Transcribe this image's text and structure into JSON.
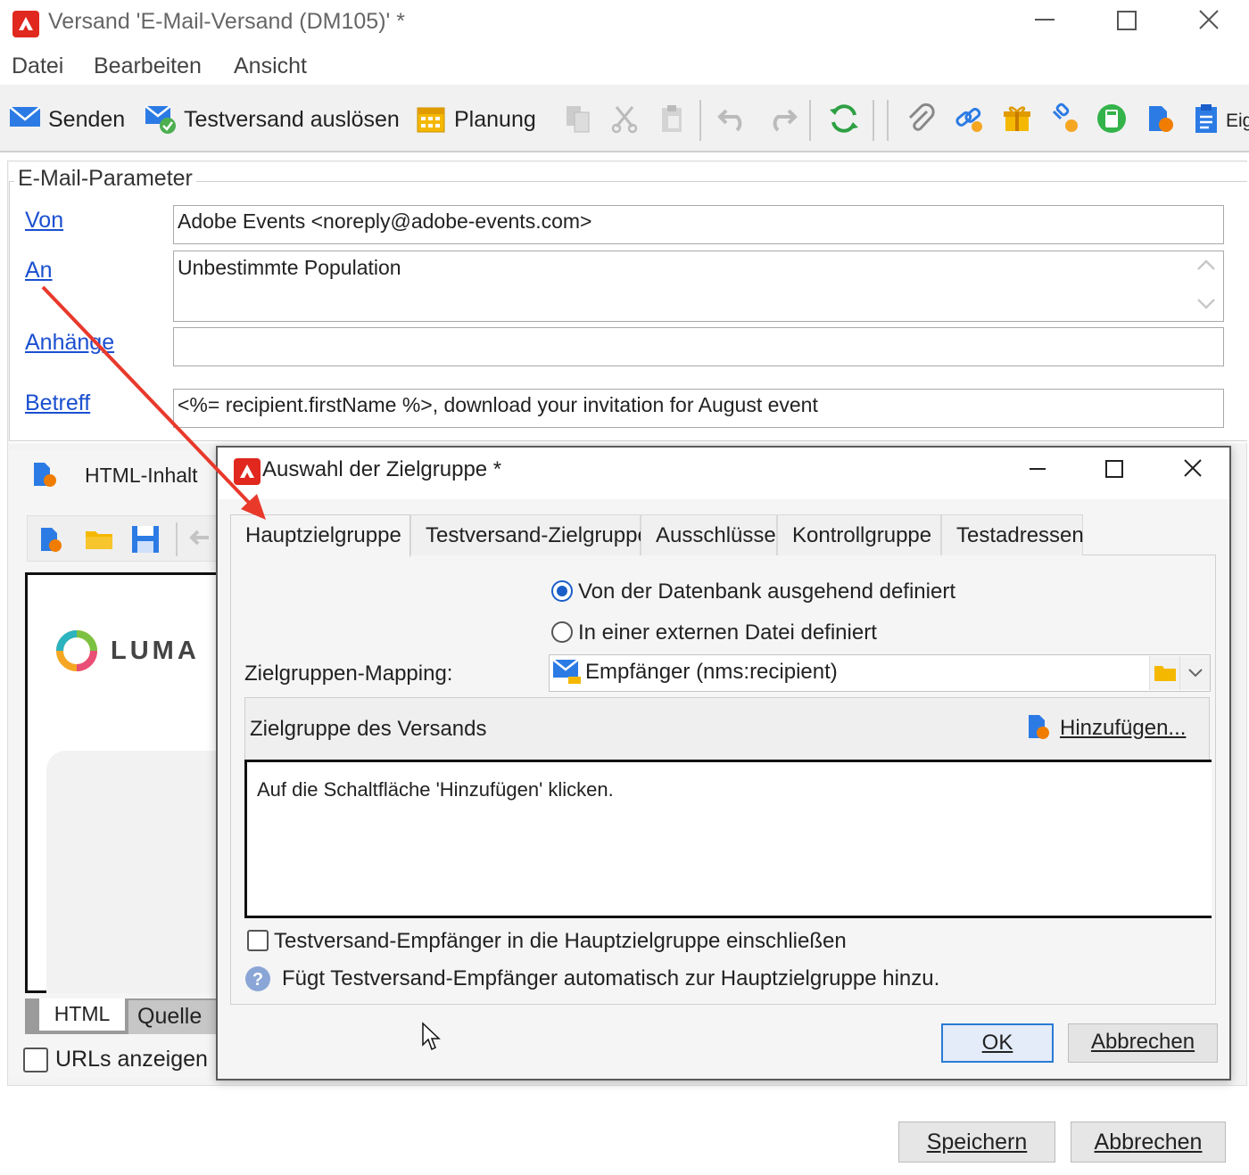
{
  "window": {
    "title": "Versand 'E-Mail-Versand (DM105)' *",
    "minimize": "—",
    "maximize": "☐",
    "close": "✕"
  },
  "menu": {
    "items": [
      "Datei",
      "Bearbeiten",
      "Ansicht"
    ]
  },
  "toolbar": {
    "send_label": "Senden",
    "test_send_label": "Testversand auslösen",
    "planning_label": "Planung",
    "overflow_label": "Eig"
  },
  "params": {
    "legend": "E-Mail-Parameter",
    "from_label": "Von",
    "from_value": "Adobe Events <noreply@adobe-events.com>",
    "to_label": "An",
    "to_value": "Unbestimmte Population",
    "attachments_label": "Anhänge",
    "attachments_value": "",
    "subject_label": "Betreff",
    "subject_value": "<%= recipient.firstName %>, download your invitation for August event"
  },
  "html_panel": {
    "title": "HTML-Inhalt",
    "logo_text": "LUMA",
    "tab_html": "HTML",
    "tab_source": "Quelle",
    "show_urls_label": "URLs anzeigen"
  },
  "footer": {
    "save_label": "Speichern",
    "cancel_label": "Abbrechen"
  },
  "dialog": {
    "title": "Auswahl der Zielgruppe *",
    "tabs": [
      "Hauptzielgruppe",
      "Testversand-Zielgruppe",
      "Ausschlüsse",
      "Kontrollgruppe",
      "Testadressen"
    ],
    "radio_db": "Von der Datenbank ausgehend definiert",
    "radio_file": "In einer externen Datei definiert",
    "mapping_label": "Zielgruppen-Mapping:",
    "mapping_value": "Empfänger (nms:recipient)",
    "target_header": "Zielgruppe des Versands",
    "add_label": "Hinzufügen...",
    "list_hint": "Auf die Schaltfläche 'Hinzufügen' klicken.",
    "include_test_label": "Testversand-Empfänger in die Hauptzielgruppe einschließen",
    "help_text": "Fügt Testversand-Empfänger automatisch zur Hauptzielgruppe hinzu.",
    "ok_label": "OK",
    "cancel_label": "Abbrechen"
  },
  "colors": {
    "accent": "#1a5ec9",
    "link": "#1a4fd0",
    "annotation_arrow": "#e8392b",
    "brand": "#e0281f"
  }
}
